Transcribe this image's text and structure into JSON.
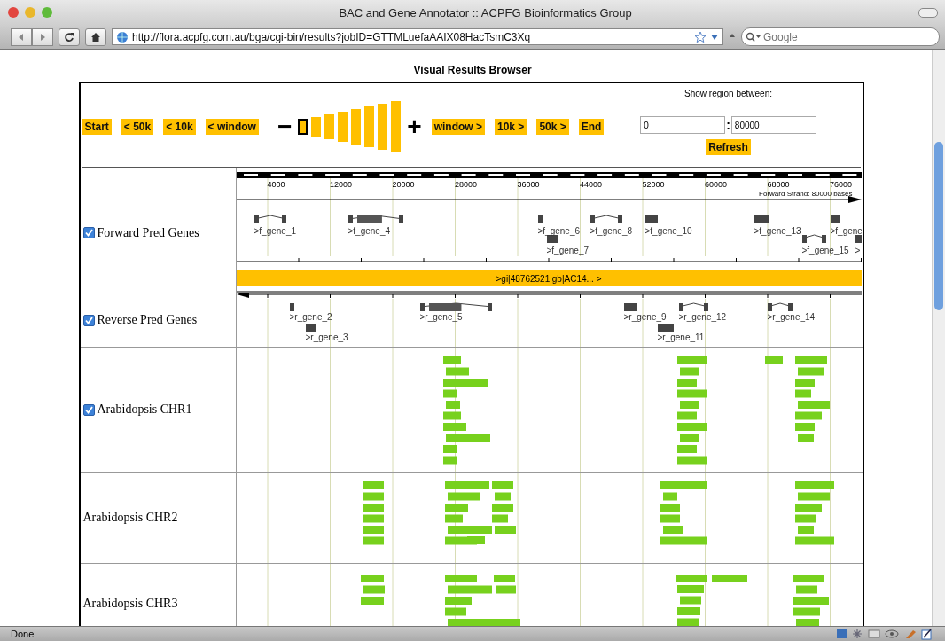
{
  "window": {
    "title": "BAC and Gene Annotator :: ACPFG Bioinformatics Group"
  },
  "toolbar": {
    "url": "http://flora.acpfg.com.au/bga/cgi-bin/results?jobID=GTTMLuefaAAIX08HacTsmC3Xq",
    "search_placeholder": "Google"
  },
  "page": {
    "heading": "Visual Results Browser",
    "nav_left": [
      "Start",
      "< 50k",
      "< 10k",
      "< window"
    ],
    "zoom_out": "−",
    "zoom_in": "+",
    "zoom_steps": [
      {
        "selected": true
      },
      {
        "selected": false
      },
      {
        "selected": false
      },
      {
        "selected": false
      },
      {
        "selected": false
      },
      {
        "selected": false
      },
      {
        "selected": false
      },
      {
        "selected": false
      }
    ],
    "nav_right": [
      "window >",
      "10k >",
      "50k >",
      "End"
    ],
    "region": {
      "label": "Show region between:",
      "from": "0",
      "separator": ":",
      "to": "80000",
      "refresh": "Refresh"
    }
  },
  "ruler": {
    "ticks": [
      "4000",
      "12000",
      "20000",
      "28000",
      "36000",
      "44000",
      "52000",
      "60000",
      "68000",
      "76000"
    ],
    "caption": "Forward Strand: 80000 bases"
  },
  "forward_genes": [
    ">f_gene_1",
    ">f_gene_4",
    ">f_gene_6",
    ">f_gene_7",
    ">f_gene_8",
    ">f_gene_10",
    ">f_gene_13",
    ">f_gene_15",
    ">f_gene",
    ">"
  ],
  "sequence_label": ">gi|48762521|gb|AC14... >",
  "reverse_genes": [
    ">r_gene_2",
    ">r_gene_3",
    ">r_gene_5",
    ">r_gene_9",
    ">r_gene_11",
    ">r_gene_12",
    ">r_gene_14"
  ],
  "tracks": [
    {
      "label": "Forward Pred Genes",
      "kind": "checkable",
      "checked": true
    },
    {
      "label": "Reverse Pred Genes",
      "kind": "checkable",
      "checked": true
    },
    {
      "label": "Arabidopsis CHR1",
      "kind": "checkable",
      "checked": true
    },
    {
      "label": "Arabidopsis CHR2",
      "kind": "plain"
    },
    {
      "label": "Arabidopsis CHR3",
      "kind": "plain"
    }
  ],
  "status_bar": {
    "text": "Done"
  }
}
